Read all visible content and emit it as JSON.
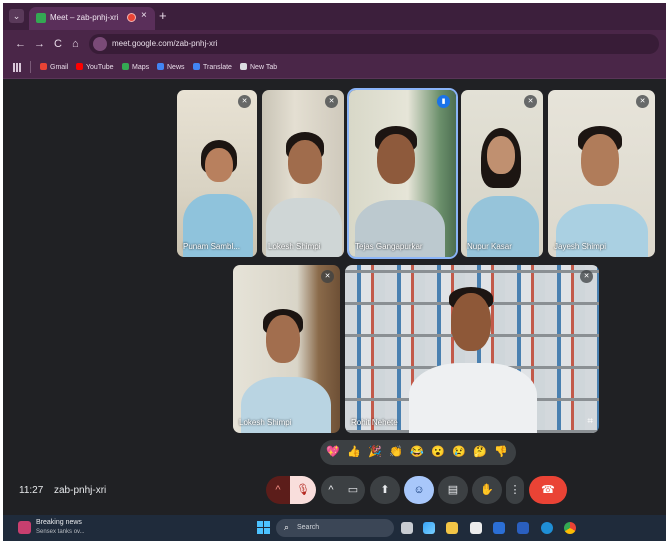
{
  "browser": {
    "tab_title": "Meet – zab-pnhj-xri",
    "tab_close": "×",
    "new_tab": "+",
    "menu": "⌄",
    "back": "←",
    "forward": "→",
    "reload": "C",
    "home": "⌂",
    "url": "meet.google.com/zab-pnhj-xri",
    "bookmarks": [
      {
        "label": "Gmail",
        "icon": "gmail-icon",
        "color": "#ea4335"
      },
      {
        "label": "YouTube",
        "icon": "youtube-icon",
        "color": "#ff0000"
      },
      {
        "label": "Maps",
        "icon": "maps-icon",
        "color": "#34a853"
      },
      {
        "label": "News",
        "icon": "news-icon",
        "color": "#4285f4"
      },
      {
        "label": "Translate",
        "icon": "translate-icon",
        "color": "#4285f4"
      },
      {
        "label": "New Tab",
        "icon": "chrome-icon",
        "color": "#dadce0"
      }
    ]
  },
  "participants": [
    {
      "name": "Punam Sambl...",
      "mic": "muted"
    },
    {
      "name": "Lokesh Shimpi",
      "mic": "muted"
    },
    {
      "name": "Tejas Gangapurkar",
      "mic": "speaking"
    },
    {
      "name": "Nupur Kasar",
      "mic": "muted"
    },
    {
      "name": "Jayesh Shimpi",
      "mic": "muted"
    },
    {
      "name": "Lokesh Shimpi",
      "mic": "muted"
    },
    {
      "name": "Rohit Nehete",
      "mic": "muted"
    }
  ],
  "reactions": [
    "💖",
    "👍",
    "🎉",
    "👏",
    "😂",
    "😮",
    "😢",
    "🤔",
    "👎"
  ],
  "meeting": {
    "time": "11:27",
    "code": "zab-pnhj-xri"
  },
  "controls": {
    "mic_chevron": "^",
    "mic_off": "🎙",
    "cam_chevron": "^",
    "camera": "▭",
    "present": "⬆",
    "emoji": "☺",
    "captions": "▤",
    "raise_hand": "✋",
    "more": "⋮",
    "leave": "☎"
  },
  "taskbar": {
    "news_title": "Breaking news",
    "news_sub": "Sensex tanks ov...",
    "search_placeholder": "Search"
  },
  "colors": {
    "meet_bg": "#202124",
    "leave_red": "#ea4335",
    "active_blue": "#8ab4f8",
    "chrome_purple": "#4a2648"
  }
}
